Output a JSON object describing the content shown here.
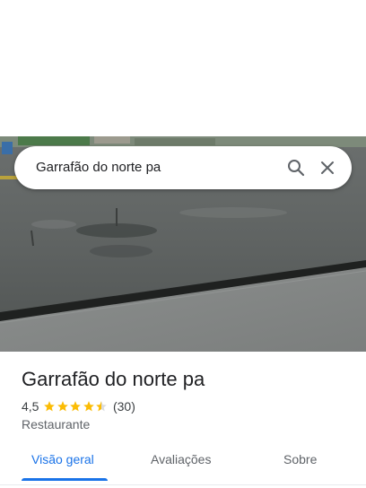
{
  "search": {
    "query": "Garrafão do norte pa",
    "search_icon": "search-icon",
    "close_icon": "close-icon"
  },
  "place": {
    "name": "Garrafão do norte pa",
    "rating": "4,5",
    "rating_stars": 4.5,
    "reviews": "(30)",
    "category": "Restaurante"
  },
  "tabs": [
    {
      "label": "Visão geral",
      "active": true
    },
    {
      "label": "Avaliações",
      "active": false
    },
    {
      "label": "Sobre",
      "active": false
    }
  ],
  "colors": {
    "accent": "#1a73e8",
    "star": "#fbbc04",
    "text_primary": "#202124",
    "text_secondary": "#5f6368"
  }
}
